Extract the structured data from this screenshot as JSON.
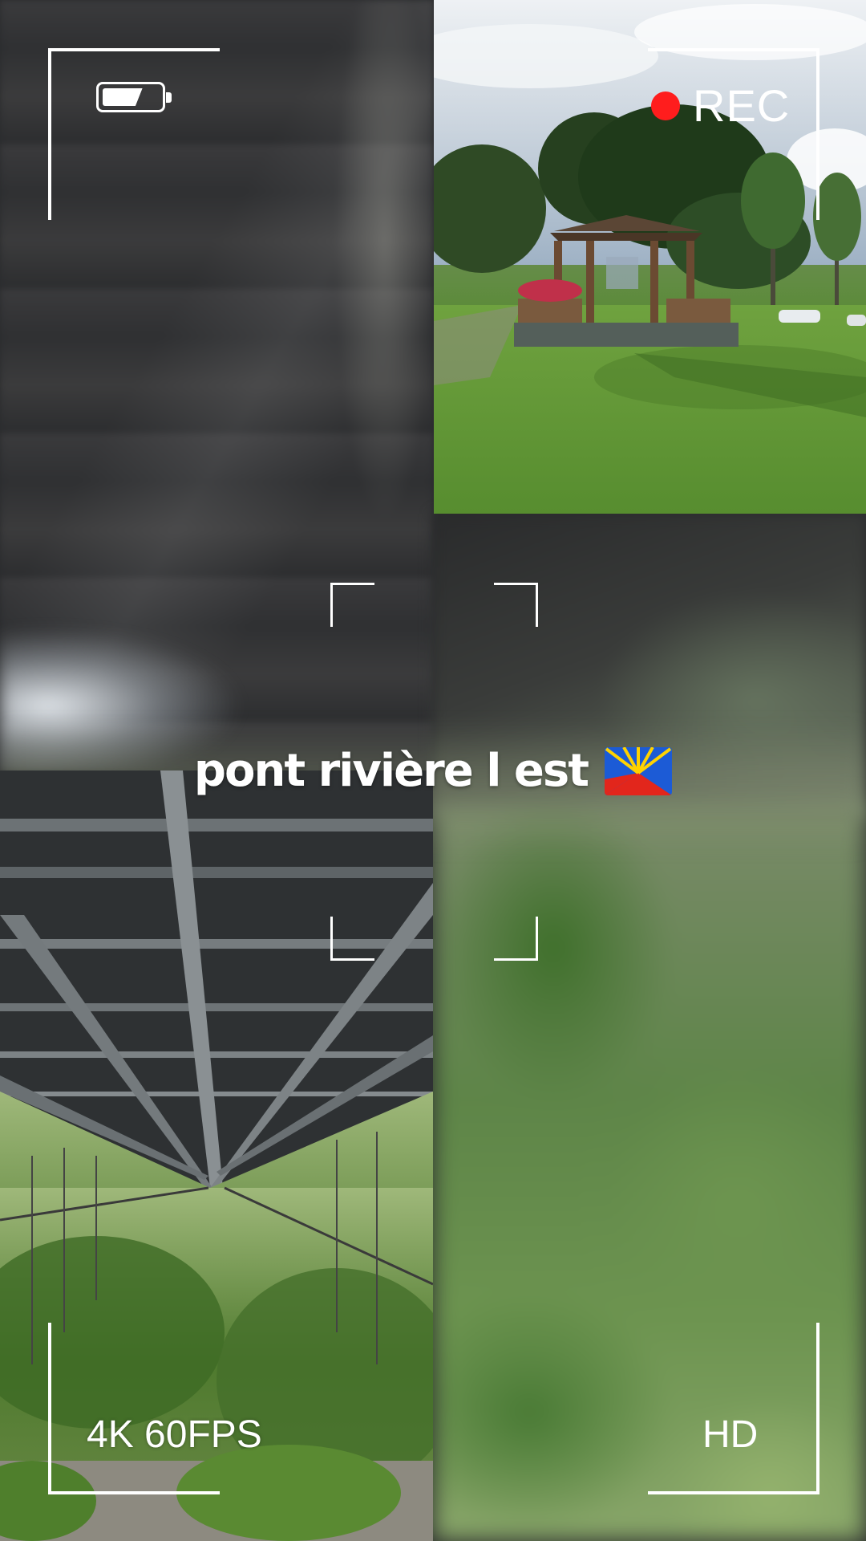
{
  "overlay": {
    "rec_label": "REC",
    "quality_label": "4K 60FPS",
    "hd_label": "HD",
    "caption": "pont rivière l est",
    "flag_icon": "reunion-flag-icon",
    "battery_icon": "battery-icon",
    "rec_color": "#ff1d1d"
  }
}
